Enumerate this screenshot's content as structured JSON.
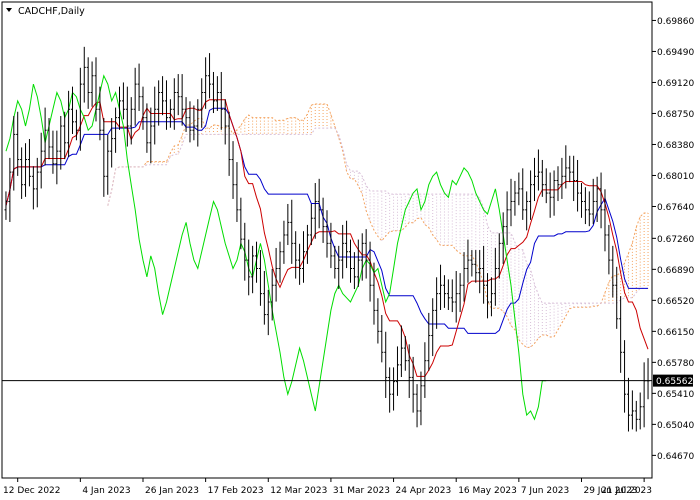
{
  "header": {
    "symbol_label": "CADCHF,Daily"
  },
  "colors": {
    "background": "#ffffff",
    "frame": "#000000",
    "bull_bar": "#000000",
    "bear_bar": "#000000",
    "tenkan": "#cc0000",
    "kijun": "#0000cc",
    "chikou": "#00dd00",
    "cloud_a": "#f4a460",
    "cloud_b": "#d8bfd8",
    "current_price_line": "#000000",
    "current_price_bg": "#000000",
    "current_price_text": "#ffffff"
  },
  "chart_data": {
    "type": "candlestick",
    "indicator": "ichimoku",
    "ylim": [
      0.644,
      0.7008
    ],
    "y_ticks": [
      "0.69860",
      "0.69490",
      "0.69120",
      "0.68750",
      "0.68380",
      "0.68010",
      "0.67640",
      "0.67260",
      "0.66890",
      "0.66520",
      "0.66150",
      "0.65780",
      "0.65410",
      "0.65040",
      "0.64670"
    ],
    "x_ticks": [
      {
        "label": "12 Dec 2022",
        "bar": 3
      },
      {
        "label": "4 Jan 2023",
        "bar": 19
      },
      {
        "label": "26 Jan 2023",
        "bar": 35
      },
      {
        "label": "17 Feb 2023",
        "bar": 51
      },
      {
        "label": "12 Mar 2023",
        "bar": 67
      },
      {
        "label": "31 Mar 2023",
        "bar": 83
      },
      {
        "label": "24 Apr 2023",
        "bar": 99
      },
      {
        "label": "16 May 2023",
        "bar": 115
      },
      {
        "label": "7 Jun 2023",
        "bar": 131
      },
      {
        "label": "29 Jun 2023",
        "bar": 147
      },
      {
        "label": "21 Jul 2023",
        "bar": 163
      }
    ],
    "bar_count": 165,
    "close": [
      0.677,
      0.6805,
      0.685,
      0.682,
      0.679,
      0.682,
      0.68,
      0.6785,
      0.6805,
      0.683,
      0.6855,
      0.6835,
      0.6815,
      0.683,
      0.686,
      0.684,
      0.688,
      0.6865,
      0.6855,
      0.691,
      0.693,
      0.69,
      0.692,
      0.688,
      0.6855,
      0.68,
      0.683,
      0.6845,
      0.687,
      0.689,
      0.688,
      0.686,
      0.688,
      0.691,
      0.6895,
      0.687,
      0.684,
      0.686,
      0.688,
      0.69,
      0.689,
      0.687,
      0.688,
      0.69,
      0.6895,
      0.688,
      0.687,
      0.6855,
      0.686,
      0.688,
      0.69,
      0.692,
      0.691,
      0.689,
      0.69,
      0.688,
      0.686,
      0.682,
      0.679,
      0.676,
      0.6725,
      0.67,
      0.668,
      0.6705,
      0.669,
      0.666,
      0.6635,
      0.665,
      0.667,
      0.669,
      0.671,
      0.673,
      0.6745,
      0.672,
      0.67,
      0.669,
      0.671,
      0.673,
      0.675,
      0.677,
      0.676,
      0.674,
      0.672,
      0.6705,
      0.669,
      0.67,
      0.672,
      0.671,
      0.669,
      0.668,
      0.67,
      0.672,
      0.67,
      0.667,
      0.664,
      0.6615,
      0.659,
      0.656,
      0.654,
      0.6555,
      0.6575,
      0.6595,
      0.658,
      0.656,
      0.654,
      0.652,
      0.655,
      0.658,
      0.661,
      0.664,
      0.666,
      0.667,
      0.666,
      0.6655,
      0.665,
      0.666,
      0.667,
      0.669,
      0.67,
      0.6695,
      0.6685,
      0.669,
      0.667,
      0.665,
      0.666,
      0.669,
      0.672,
      0.674,
      0.676,
      0.677,
      0.678,
      0.6785,
      0.676,
      0.677,
      0.679,
      0.68,
      0.6805,
      0.679,
      0.678,
      0.6775,
      0.6795,
      0.679,
      0.68,
      0.681,
      0.6805,
      0.6795,
      0.678,
      0.677,
      0.676,
      0.6755,
      0.677,
      0.6785,
      0.676,
      0.673,
      0.67,
      0.667,
      0.663,
      0.659,
      0.654,
      0.6515,
      0.652,
      0.651,
      0.6525,
      0.6556,
      0.6556
    ],
    "current_price": "0.65562"
  }
}
